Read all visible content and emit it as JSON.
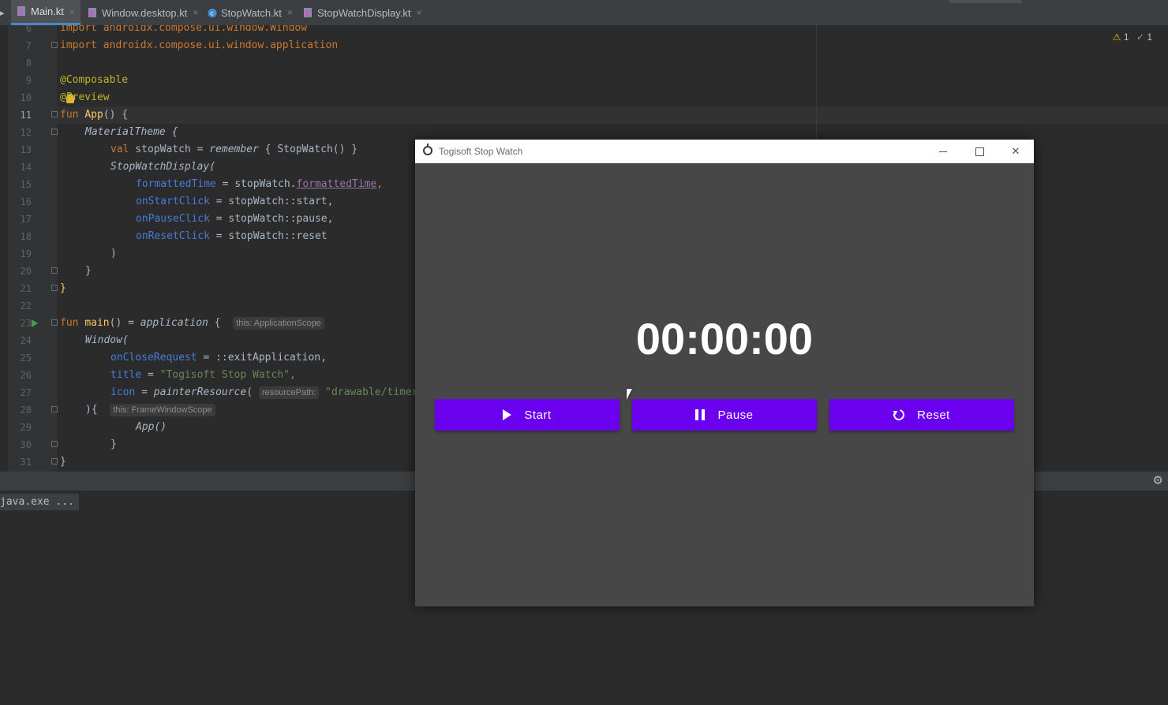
{
  "ide": {
    "tabs": [
      {
        "label": "Main.kt"
      },
      {
        "label": "Window.desktop.kt"
      },
      {
        "label": "StopWatch.kt"
      },
      {
        "label": "StopWatchDisplay.kt"
      }
    ],
    "close_glyph": "×",
    "inspections": {
      "warnings": "1",
      "ok": "1"
    },
    "line_numbers": [
      "6",
      "7",
      "8",
      "9",
      "10",
      "11",
      "12",
      "13",
      "14",
      "15",
      "16",
      "17",
      "18",
      "19",
      "20",
      "21",
      "22",
      "23",
      "24",
      "25",
      "26",
      "27",
      "28",
      "29",
      "30",
      "31"
    ],
    "code": {
      "l6": "import androidx.compose.ui.window.Window",
      "l7": "import androidx.compose.ui.window.application",
      "l9": "@Composable",
      "l10": "@Preview",
      "l11_kw": "fun",
      "l11_name": "App",
      "l11_rest": "() {",
      "l12": "MaterialTheme {",
      "l13_kw": "val",
      "l13_a": " stopWatch = ",
      "l13_b": "remember",
      "l13_c": " { StopWatch() }",
      "l14": "StopWatchDisplay(",
      "l15_p": "formattedTime",
      "l15_a": " = stopWatch.",
      "l15_b": "formattedTime",
      "l15_c": ",",
      "l16_p": "onStartClick",
      "l16_a": " = stopWatch::start,",
      "l17_p": "onPauseClick",
      "l17_a": " = stopWatch::pause,",
      "l18_p": "onResetClick",
      "l18_a": " = stopWatch::reset",
      "l19": ")",
      "l20": "}",
      "l21": "}",
      "l23_kw": "fun",
      "l23_name": "main",
      "l23_a": "() = ",
      "l23_b": "application",
      "l23_c": " {",
      "l23_hint": "this: ApplicationScope",
      "l24": "Window(",
      "l25_p": "onCloseRequest",
      "l25_a": " = ::exitApplication,",
      "l26_p": "title",
      "l26_a": " = ",
      "l26_s": "\"Togisoft Stop Watch\"",
      "l26_c": ",",
      "l27_p": "icon",
      "l27_a": " = ",
      "l27_b": "painterResource",
      "l27_c": "( ",
      "l27_hint": "resourcePath:",
      "l27_s": " \"drawable/timer",
      "l28": "){",
      "l28_hint": "this: FrameWindowScope",
      "l29": "App()",
      "l30": "}",
      "l31": "}"
    },
    "console_chip": "java.exe ..."
  },
  "app": {
    "title": "Togisoft Stop Watch",
    "time": "00:00:00",
    "buttons": {
      "start": "Start",
      "pause": "Pause",
      "reset": "Reset"
    },
    "close_glyph": "✕",
    "accent": "#6a00ee"
  },
  "colors": {
    "editor_bg": "#2b2b2b",
    "keyword": "#cc7832",
    "annotation": "#bbb529",
    "function": "#ffc66d",
    "param": "#467cda",
    "string": "#6a8759"
  }
}
